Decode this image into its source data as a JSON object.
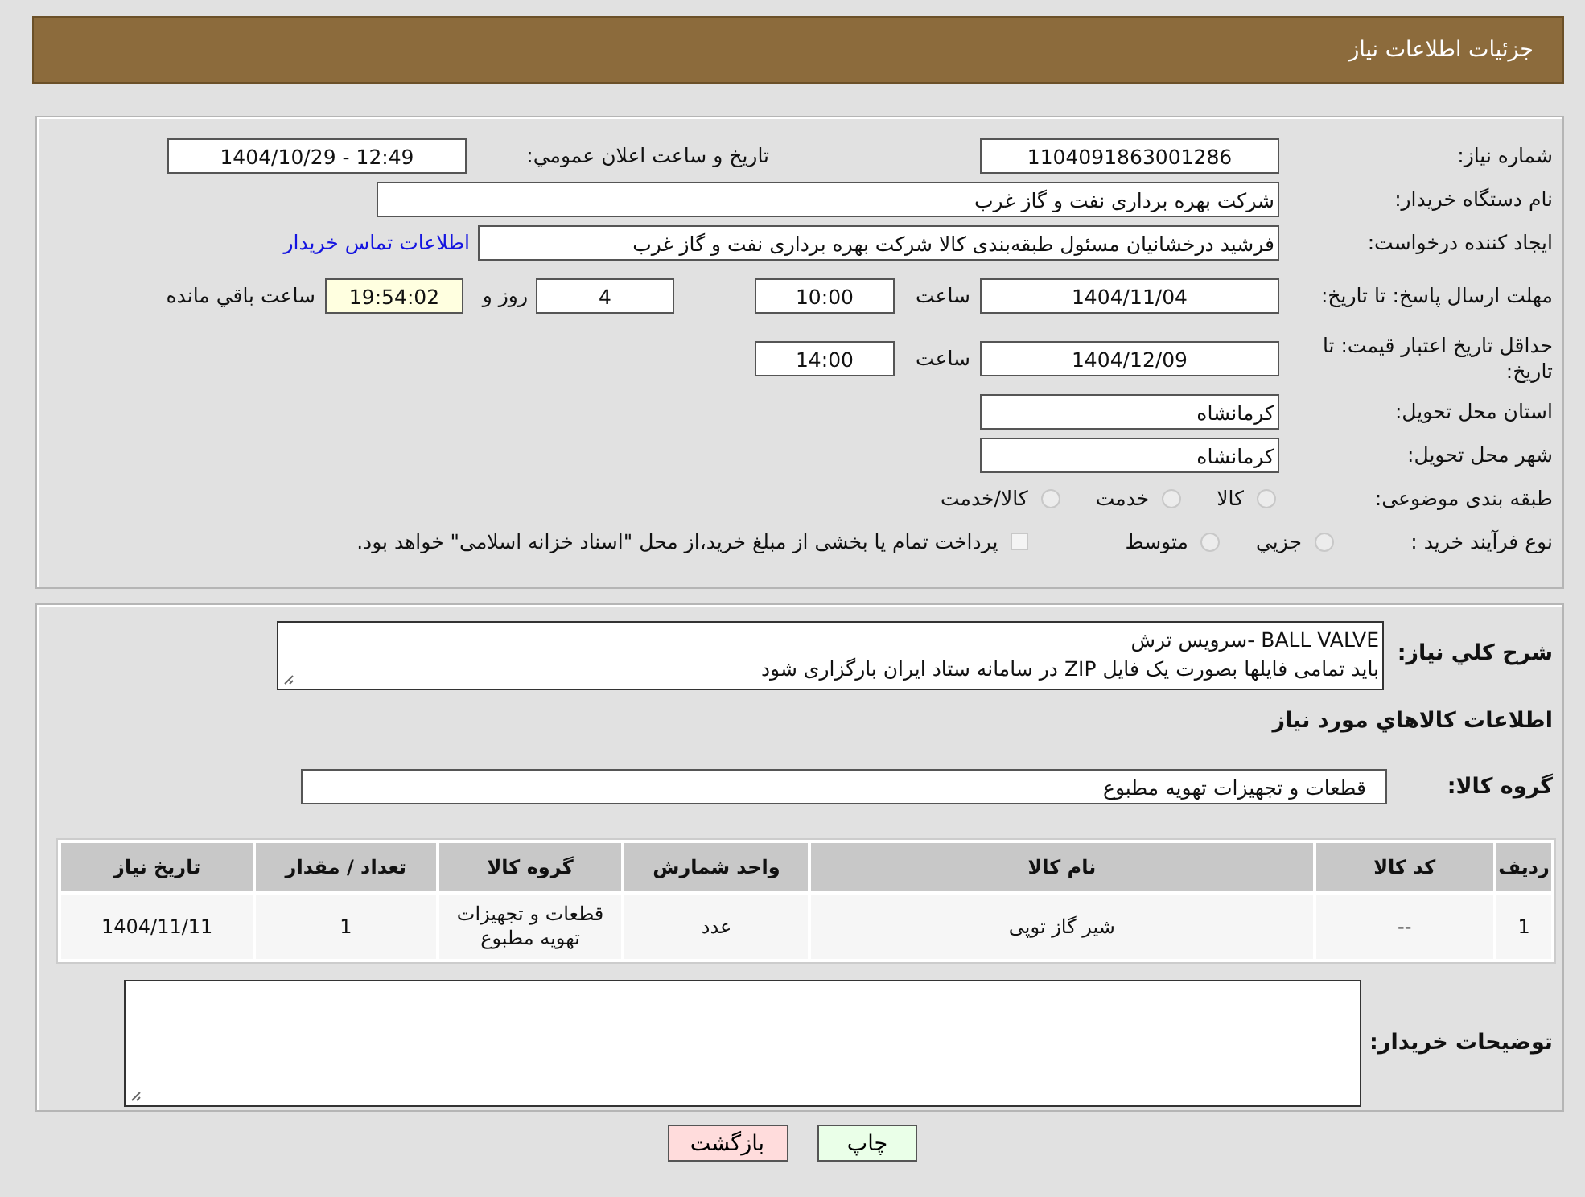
{
  "header": {
    "title": "جزئیات اطلاعات نیاز"
  },
  "need_number": {
    "label": "شماره نیاز:",
    "value": "1104091863001286"
  },
  "announce": {
    "label": "تاریخ و ساعت اعلان عمومي:",
    "value": "1404/10/29 - 12:49"
  },
  "buyer": {
    "label": "نام دستگاه خریدار:",
    "value": "شرکت بهره برداری نفت و گاز غرب"
  },
  "creator": {
    "label": "ایجاد کننده درخواست:",
    "value": "فرشید درخشانیان مسئول طبقه‌بندی کالا شرکت بهره برداری نفت و گاز غرب",
    "link": "اطلاعات تماس خریدار"
  },
  "reply_deadline": {
    "label": "مهلت ارسال پاسخ: تا تاریخ:",
    "date": "1404/11/04",
    "time_label": "ساعت",
    "time": "10:00",
    "days": "4",
    "days_label": "روز و",
    "remaining": "19:54:02",
    "remaining_label": "ساعت باقي مانده"
  },
  "price_validity": {
    "label": "حداقل تاریخ اعتبار قیمت: تا تاریخ:",
    "date": "1404/12/09",
    "time_label": "ساعت",
    "time": "14:00"
  },
  "province": {
    "label": "استان محل تحویل:",
    "value": "کرمانشاه"
  },
  "city": {
    "label": "شهر محل تحویل:",
    "value": "کرمانشاه"
  },
  "category": {
    "label": "طبقه بندی موضوعی:",
    "options": [
      {
        "label": "کالا",
        "selected": false
      },
      {
        "label": "خدمت",
        "selected": false
      },
      {
        "label": "کالا/خدمت",
        "selected": false
      }
    ]
  },
  "purchase_type": {
    "label": "نوع فرآیند خرید :",
    "options": [
      {
        "label": "جزيي",
        "selected": false
      },
      {
        "label": "متوسط",
        "selected": false
      }
    ],
    "checkbox": {
      "label": "پرداخت تمام یا بخشی از مبلغ خرید،از محل \"اسناد خزانه اسلامی\" خواهد بود.",
      "checked": false
    }
  },
  "description": {
    "label": "شرح كلي نياز:",
    "lines": [
      "BALL VALVE -سرویس ترش",
      "باید تمامی فایلها بصورت یک فایل ZIP در سامانه ستاد ایران بارگزاری شود"
    ]
  },
  "goods_title": "اطلاعات كالاهاي مورد نياز",
  "goods_group": {
    "label": "گروه کالا:",
    "value": "قطعات و تجهیزات تهویه مطبوع"
  },
  "table": {
    "columns": [
      "ردیف",
      "کد کالا",
      "نام کالا",
      "واحد شمارش",
      "گروه کالا",
      "تعداد / مقدار",
      "تاریخ نیاز"
    ],
    "rows": [
      [
        "1",
        "--",
        "شیر گاز توپی",
        "عدد",
        "قطعات و تجهیزات تهویه مطبوع",
        "1",
        "1404/11/11"
      ]
    ]
  },
  "buyer_notes": {
    "label": "توضیحات خریدار:"
  },
  "buttons": [
    {
      "label": "چاپ",
      "kind": "print"
    },
    {
      "label": "بازگشت",
      "kind": "back"
    }
  ]
}
